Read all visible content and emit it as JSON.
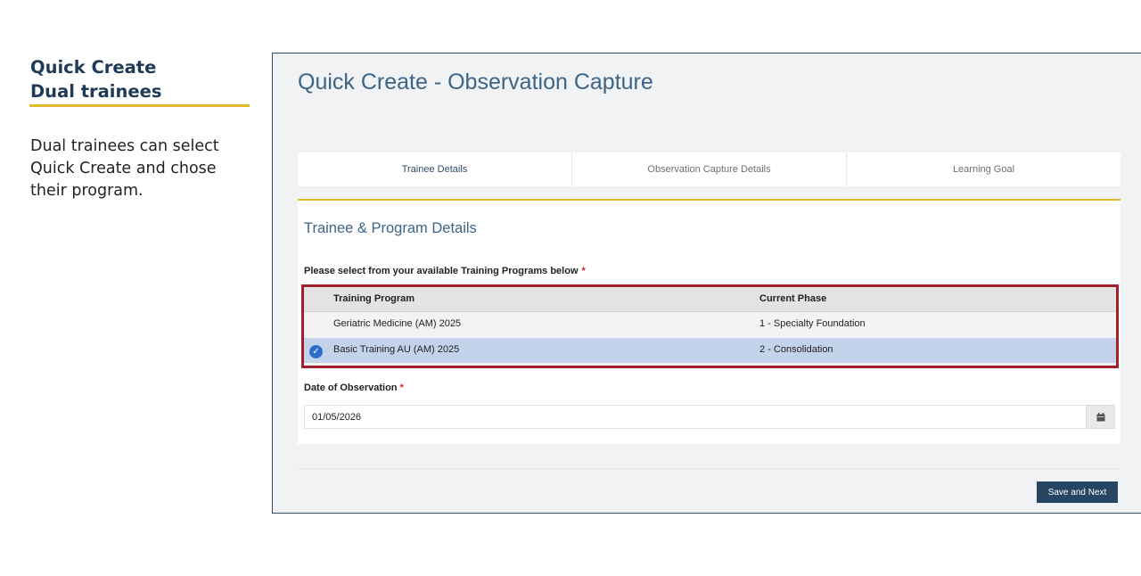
{
  "slide": {
    "title_line1": "Quick Create",
    "title_line2": "Dual trainees",
    "description": "Dual trainees can select Quick Create and chose their program."
  },
  "app": {
    "page_title": "Quick Create - Observation Capture",
    "tabs": [
      {
        "label": "Trainee Details",
        "active": true
      },
      {
        "label": "Observation Capture Details",
        "active": false
      },
      {
        "label": "Learning Goal",
        "active": false
      }
    ],
    "section_title": "Trainee & Program Details",
    "select_label": "Please select from your available Training Programs below",
    "required_mark": "*",
    "table": {
      "headers": {
        "program": "Training Program",
        "phase": "Current Phase"
      },
      "rows": [
        {
          "program": "Geriatric Medicine (AM) 2025",
          "phase": "1 - Specialty Foundation",
          "selected": false
        },
        {
          "program": "Basic Training AU (AM) 2025",
          "phase": "2 - Consolidation",
          "selected": true
        }
      ]
    },
    "date_label": "Date of Observation",
    "date_value": "01/05/2026",
    "save_button": "Save and Next"
  },
  "colors": {
    "navy": "#254562",
    "accent_gold": "#e2b92a",
    "highlight_red": "#a3202b",
    "selected_row": "#c3d3eb",
    "title_blue": "#3c6487"
  },
  "icons": {
    "selected_check": "check-circle-icon",
    "date_picker": "calendar-icon"
  }
}
